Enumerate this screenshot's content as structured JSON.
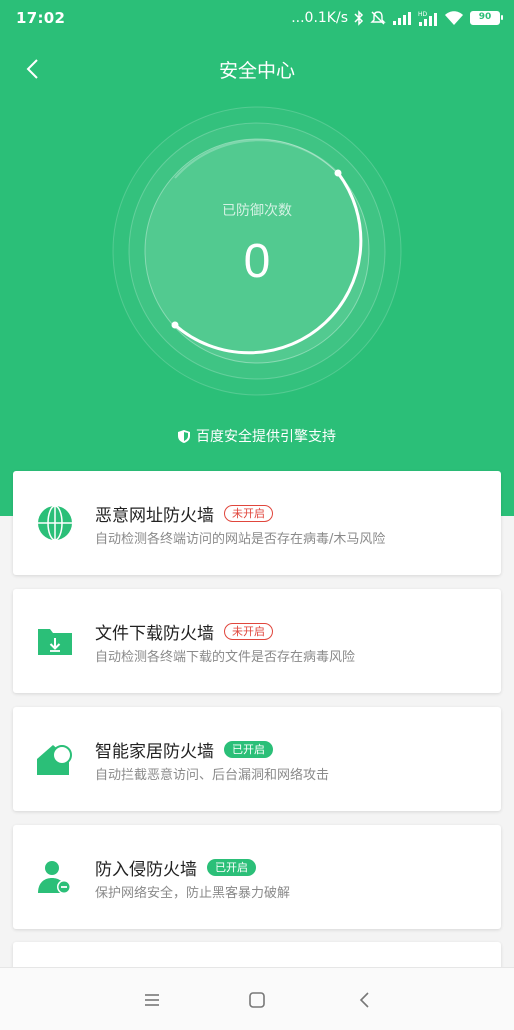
{
  "status_bar": {
    "time": "17:02",
    "network_speed": "...0.1K/s",
    "battery_level": "90",
    "icons": [
      "bluetooth-icon",
      "mute-icon",
      "signal-icon",
      "hd-signal-icon",
      "wifi-icon",
      "battery-icon"
    ]
  },
  "header": {
    "title": "安全中心",
    "back_icon": "chevron-left-icon"
  },
  "counter": {
    "label": "已防御次数",
    "value": "0"
  },
  "provider": {
    "text": "百度安全提供引擎支持",
    "icon": "shield-icon"
  },
  "cards": [
    {
      "title": "恶意网址防火墙",
      "status": "未开启",
      "enabled": false,
      "description": "自动检测各终端访问的网站是否存在病毒/木马风险",
      "icon": "globe-icon"
    },
    {
      "title": "文件下载防火墙",
      "status": "未开启",
      "enabled": false,
      "description": "自动检测各终端下载的文件是否存在病毒风险",
      "icon": "folder-download-icon"
    },
    {
      "title": "智能家居防火墙",
      "status": "已开启",
      "enabled": true,
      "description": "自动拦截恶意访问、后台漏洞和网络攻击",
      "icon": "smart-home-icon"
    },
    {
      "title": "防入侵防火墙",
      "status": "已开启",
      "enabled": true,
      "description": "保护网络安全，防止黑客暴力破解",
      "icon": "user-shield-icon"
    }
  ],
  "nav": {
    "icons": [
      "menu-icon",
      "home-icon",
      "back-icon"
    ]
  },
  "colors": {
    "brand": "#2bbf78",
    "badge_off": "#e0463c",
    "background": "#f4f4f4"
  }
}
